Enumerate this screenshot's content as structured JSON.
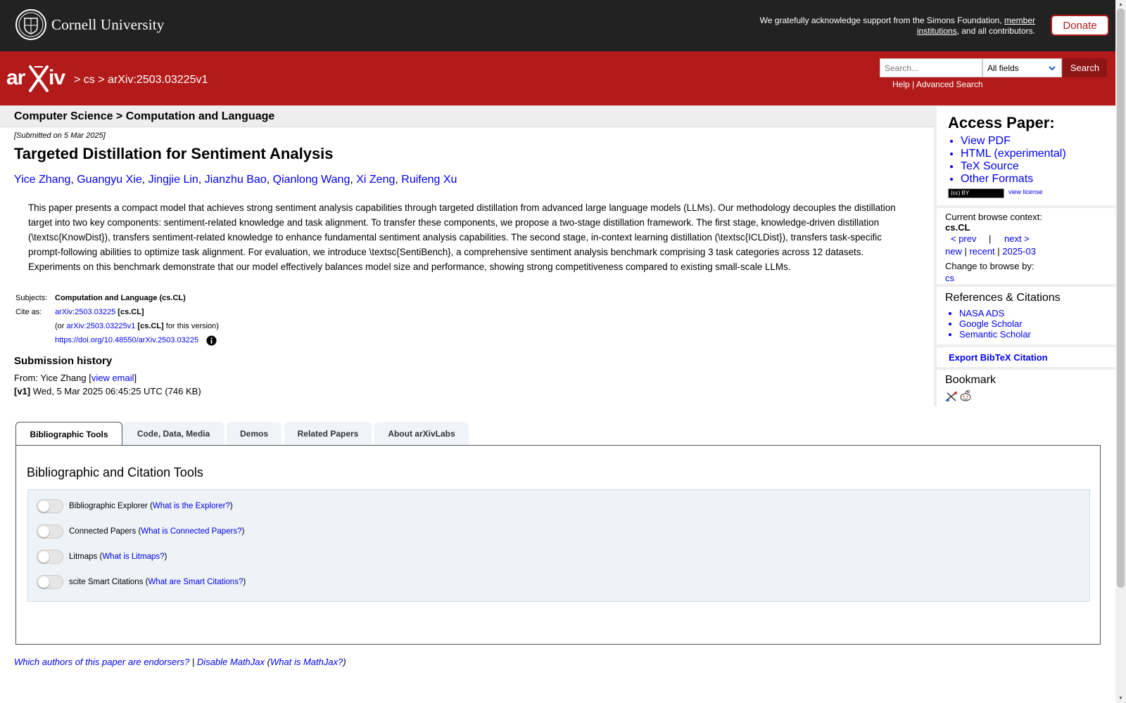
{
  "topbar": {
    "university": "Cornell University",
    "support_pre": "We gratefully acknowledge support from the Simons Foundation,",
    "support_link": "member institutions",
    "support_post": ", and all contributors.",
    "donate": "Donate"
  },
  "header": {
    "breadcrumb_sep1": "> ",
    "breadcrumb_cs": "cs",
    "breadcrumb_sep2": " > ",
    "breadcrumb_id": "arXiv:2503.03225v1",
    "search_placeholder": "Search...",
    "search_field": "All fields",
    "search_button": "Search",
    "help": "Help",
    "links_sep": " | ",
    "advanced": "Advanced Search"
  },
  "subheader": "Computer Science > Computation and Language",
  "paper": {
    "submitted": "[Submitted on 5 Mar 2025]",
    "title": "Targeted Distillation for Sentiment Analysis",
    "authors": [
      "Yice Zhang",
      "Guangyu Xie",
      "Jingjie Lin",
      "Jianzhu Bao",
      "Qianlong Wang",
      "Xi Zeng",
      "Ruifeng Xu"
    ],
    "abstract": "This paper presents a compact model that achieves strong sentiment analysis capabilities through targeted distillation from advanced large language models (LLMs). Our methodology decouples the distillation target into two key components: sentiment-related knowledge and task alignment. To transfer these components, we propose a two-stage distillation framework. The first stage, knowledge-driven distillation (\\textsc{KnowDist}), transfers sentiment-related knowledge to enhance fundamental sentiment analysis capabilities. The second stage, in-context learning distillation (\\textsc{ICLDist}), transfers task-specific prompt-following abilities to optimize task alignment. For evaluation, we introduce \\textsc{SentiBench}, a comprehensive sentiment analysis benchmark comprising 3 task categories across 12 datasets. Experiments on this benchmark demonstrate that our model effectively balances model size and performance, showing strong competitiveness compared to existing small-scale LLMs."
  },
  "meta": {
    "subjects_label": "Subjects:",
    "subjects_value": "Computation and Language (cs.CL)",
    "cite_label": "Cite as:",
    "cite_id": "arXiv:2503.03225",
    "cite_cat": " [cs.CL]",
    "or_pre": "(or ",
    "or_id": "arXiv:2503.03225v1",
    "or_cat": " [cs.CL]",
    "or_post": " for this version)",
    "doi": "https://doi.org/10.48550/arXiv.2503.03225"
  },
  "history": {
    "title": "Submission history",
    "from_pre": "From: Yice Zhang [",
    "view_email": "view email",
    "from_post": "]",
    "v1_label": "[v1]",
    "v1_text": " Wed, 5 Mar 2025 06:45:25 UTC (746 KB)"
  },
  "sidebar": {
    "access_title": "Access Paper:",
    "access_links": [
      "View PDF",
      "HTML (experimental)",
      "TeX Source",
      "Other Formats"
    ],
    "cc_badge": "(cc) BY",
    "view_license": "view license",
    "context_label": "Current browse context:",
    "context_value": "cs.CL",
    "prev": "< prev",
    "nav_sep": "|",
    "next": "next >",
    "new": "new",
    "recent": "recent",
    "month": "2025-03",
    "change_label": "Change to browse by:",
    "change_cs": "cs",
    "refs_title": "References & Citations",
    "refs_links": [
      "NASA ADS",
      "Google Scholar",
      "Semantic Scholar"
    ],
    "export": "Export BibTeX Citation",
    "bookmark_title": "Bookmark"
  },
  "tabs": [
    "Bibliographic Tools",
    "Code, Data, Media",
    "Demos",
    "Related Papers",
    "About arXivLabs"
  ],
  "panel": {
    "title": "Bibliographic and Citation Tools",
    "tools": [
      {
        "label": "Bibliographic Explorer",
        "link": "What is the Explorer?"
      },
      {
        "label": "Connected Papers",
        "link": "What is Connected Papers?"
      },
      {
        "label": "Litmaps",
        "link": "What is Litmaps?"
      },
      {
        "label": "scite Smart Citations",
        "link": "What are Smart Citations?"
      }
    ]
  },
  "footer": {
    "endorsers": "Which authors of this paper are endorsers?",
    "sep": " | ",
    "disable_mathjax": "Disable MathJax",
    "what_mathjax": "What is MathJax?"
  },
  "colors": {
    "brand_red": "#b31b1b",
    "topbar": "#222222",
    "link": "#0000ee"
  }
}
